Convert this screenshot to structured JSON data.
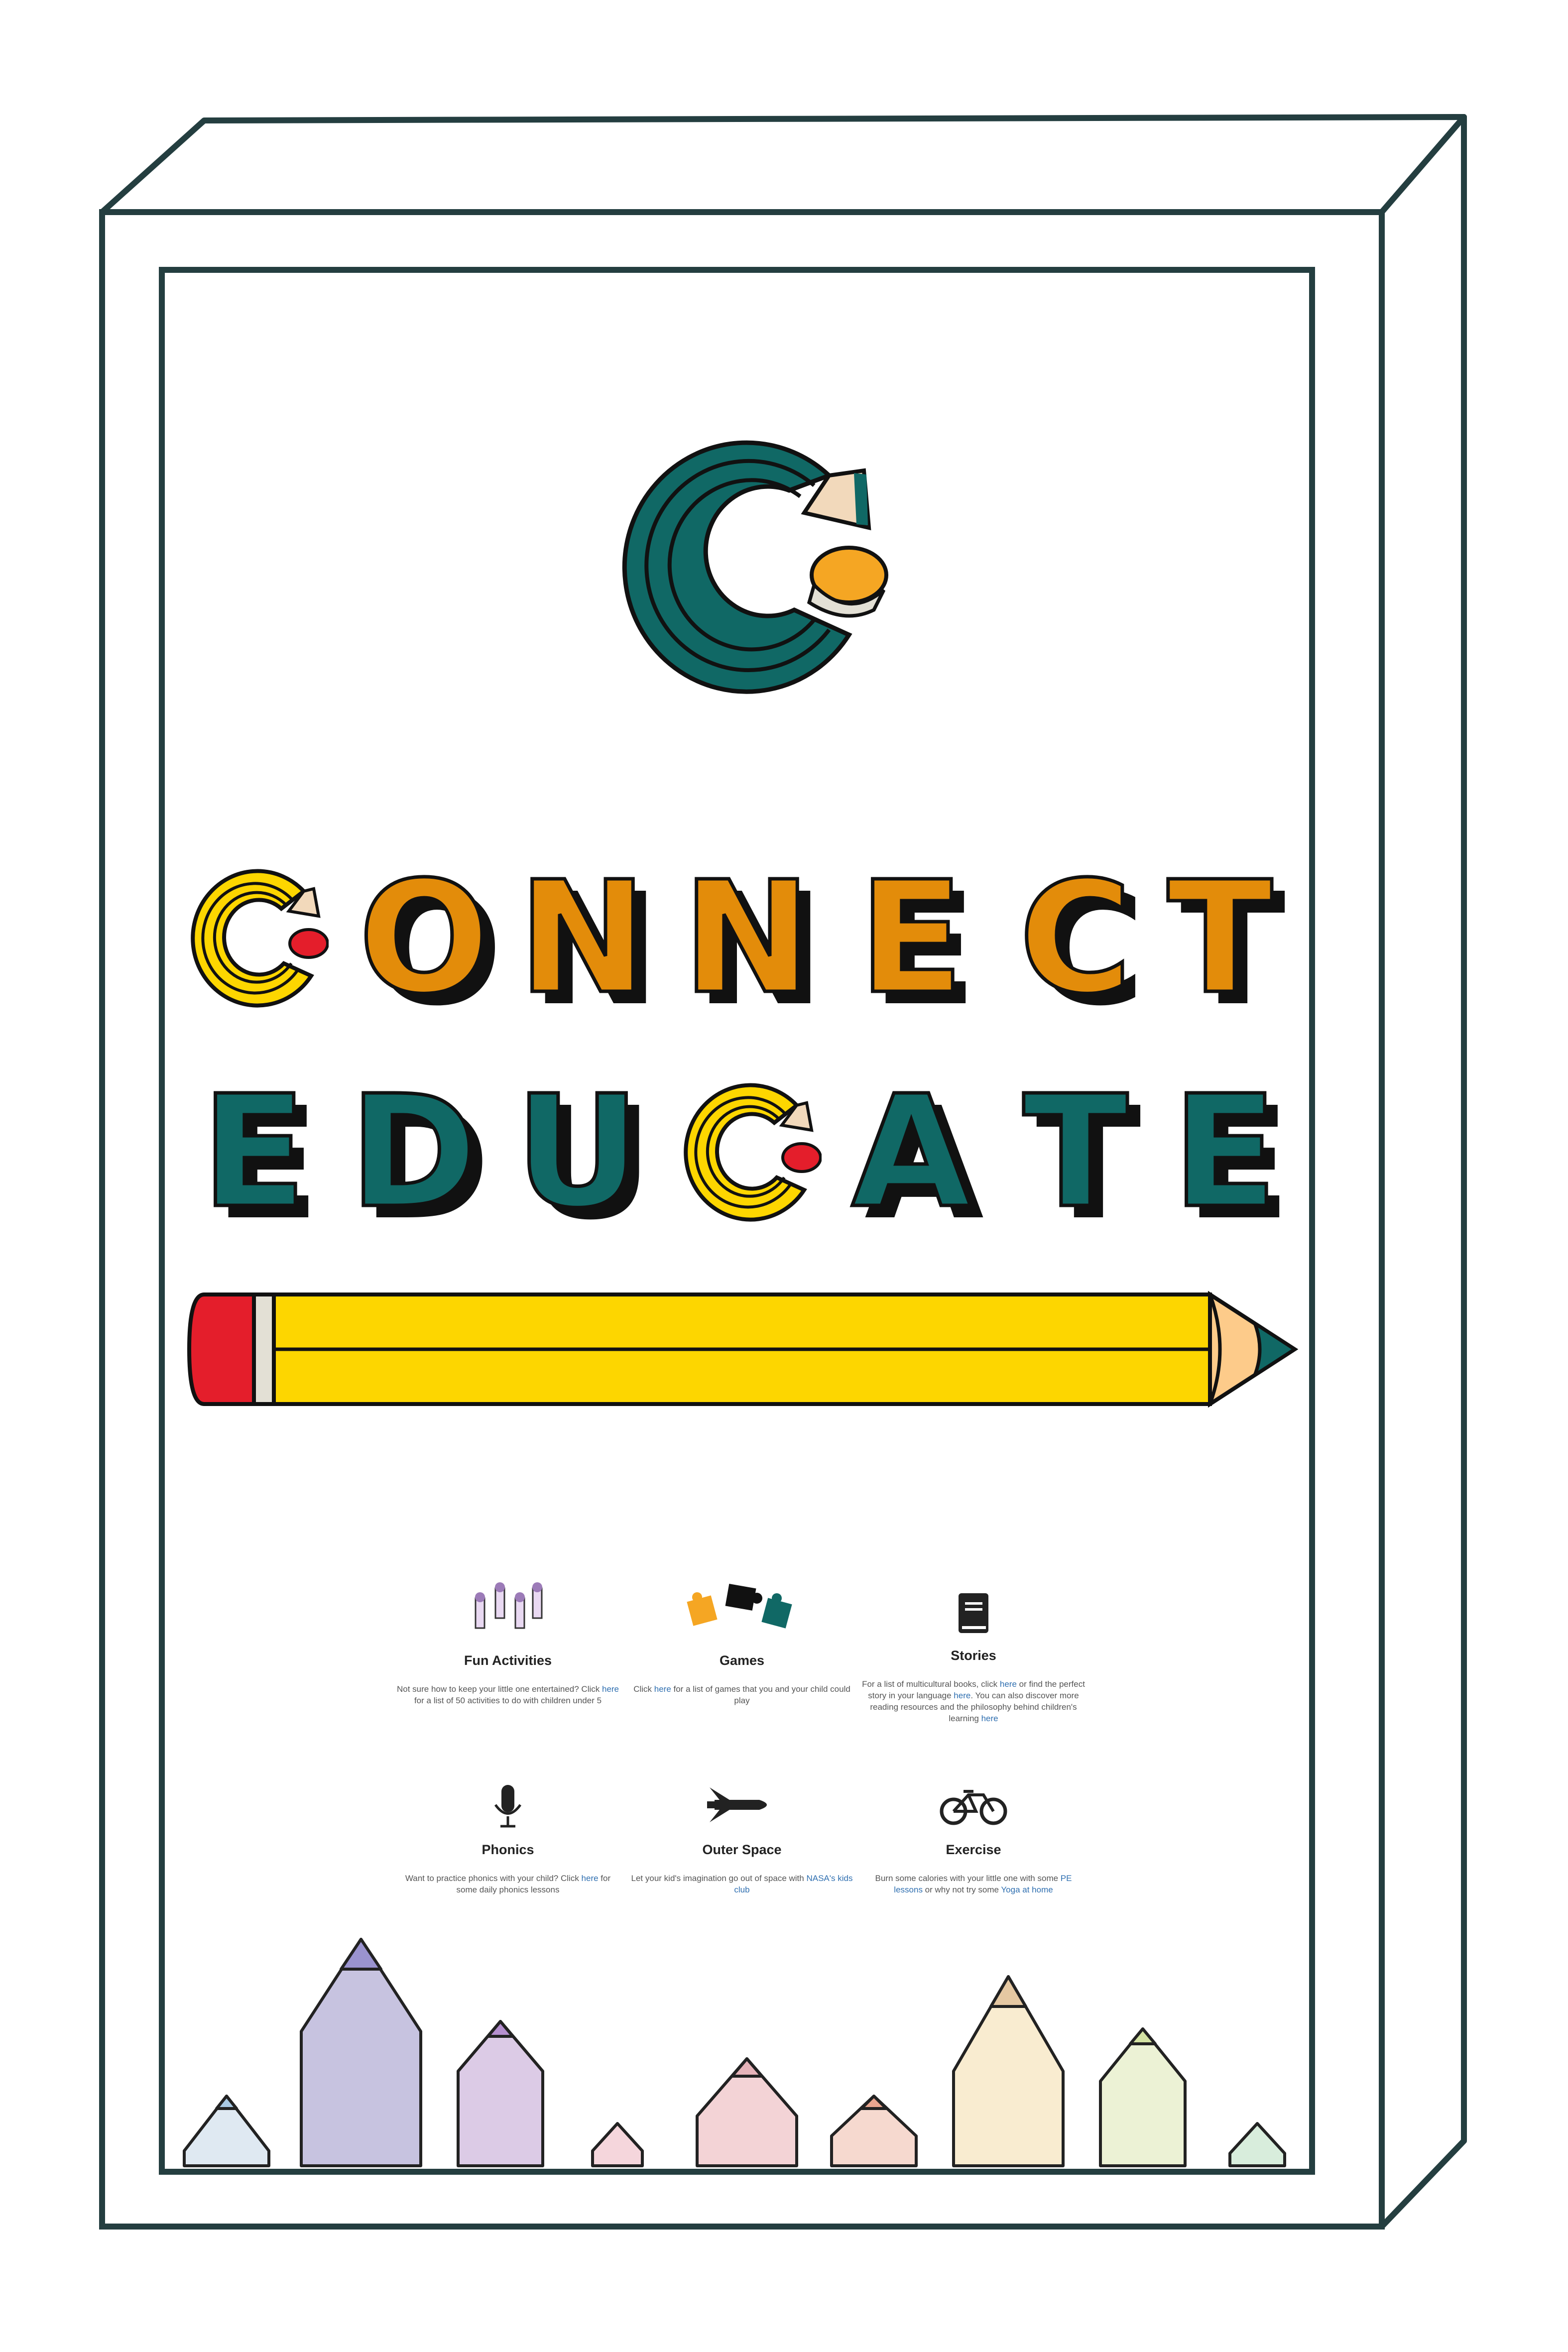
{
  "logo": {
    "title_line1": [
      "C",
      "O",
      "N",
      "N",
      "E",
      "C",
      "T"
    ],
    "title_line2": [
      "E",
      "D",
      "U",
      "C",
      "A",
      "T",
      "E"
    ]
  },
  "colors": {
    "teal": "#106865",
    "orange": "#e38c0a",
    "yellow": "#fdd600",
    "frame": "#243e40",
    "link": "#2f6fb0",
    "eraser_red": "#e41e2b",
    "pencil_tip": "#fdcb8a"
  },
  "features": [
    {
      "icon": "pencils-icon",
      "title": "Fun Activities",
      "desc_pre": "Not sure how to keep your little one entertained? Click ",
      "link": "here",
      "desc_post": " for a list of 50 activities to do with children under 5"
    },
    {
      "icon": "puzzle-icon",
      "title": "Games",
      "desc_pre": "Click ",
      "link": "here",
      "desc_post": " for a list of games that you and your child could play"
    },
    {
      "icon": "book-icon",
      "title": "Stories",
      "desc_pre": "For a list of multicultural books, click ",
      "link": "here",
      "desc_mid": " or find the perfect story in your language ",
      "link2": "here",
      "desc_mid2": ". You can also discover more reading resources and the philosophy behind children's learning ",
      "link3": "here",
      "desc_post": ""
    },
    {
      "icon": "microphone-icon",
      "title": "Phonics",
      "desc_pre": "Want to practice phonics with your child? Click ",
      "link": "here",
      "desc_post": " for some daily phonics lessons"
    },
    {
      "icon": "space-shuttle-icon",
      "title": "Outer Space",
      "desc_pre": "Let your kid's imagination go out of space with ",
      "link": "NASA's kids club",
      "desc_post": ""
    },
    {
      "icon": "bicycle-icon",
      "title": "Exercise",
      "desc_pre": "Burn some calories with your little one with some ",
      "link": "PE lessons",
      "desc_mid": " or why not try some ",
      "link2": "Yoga at home",
      "desc_post": ""
    }
  ]
}
